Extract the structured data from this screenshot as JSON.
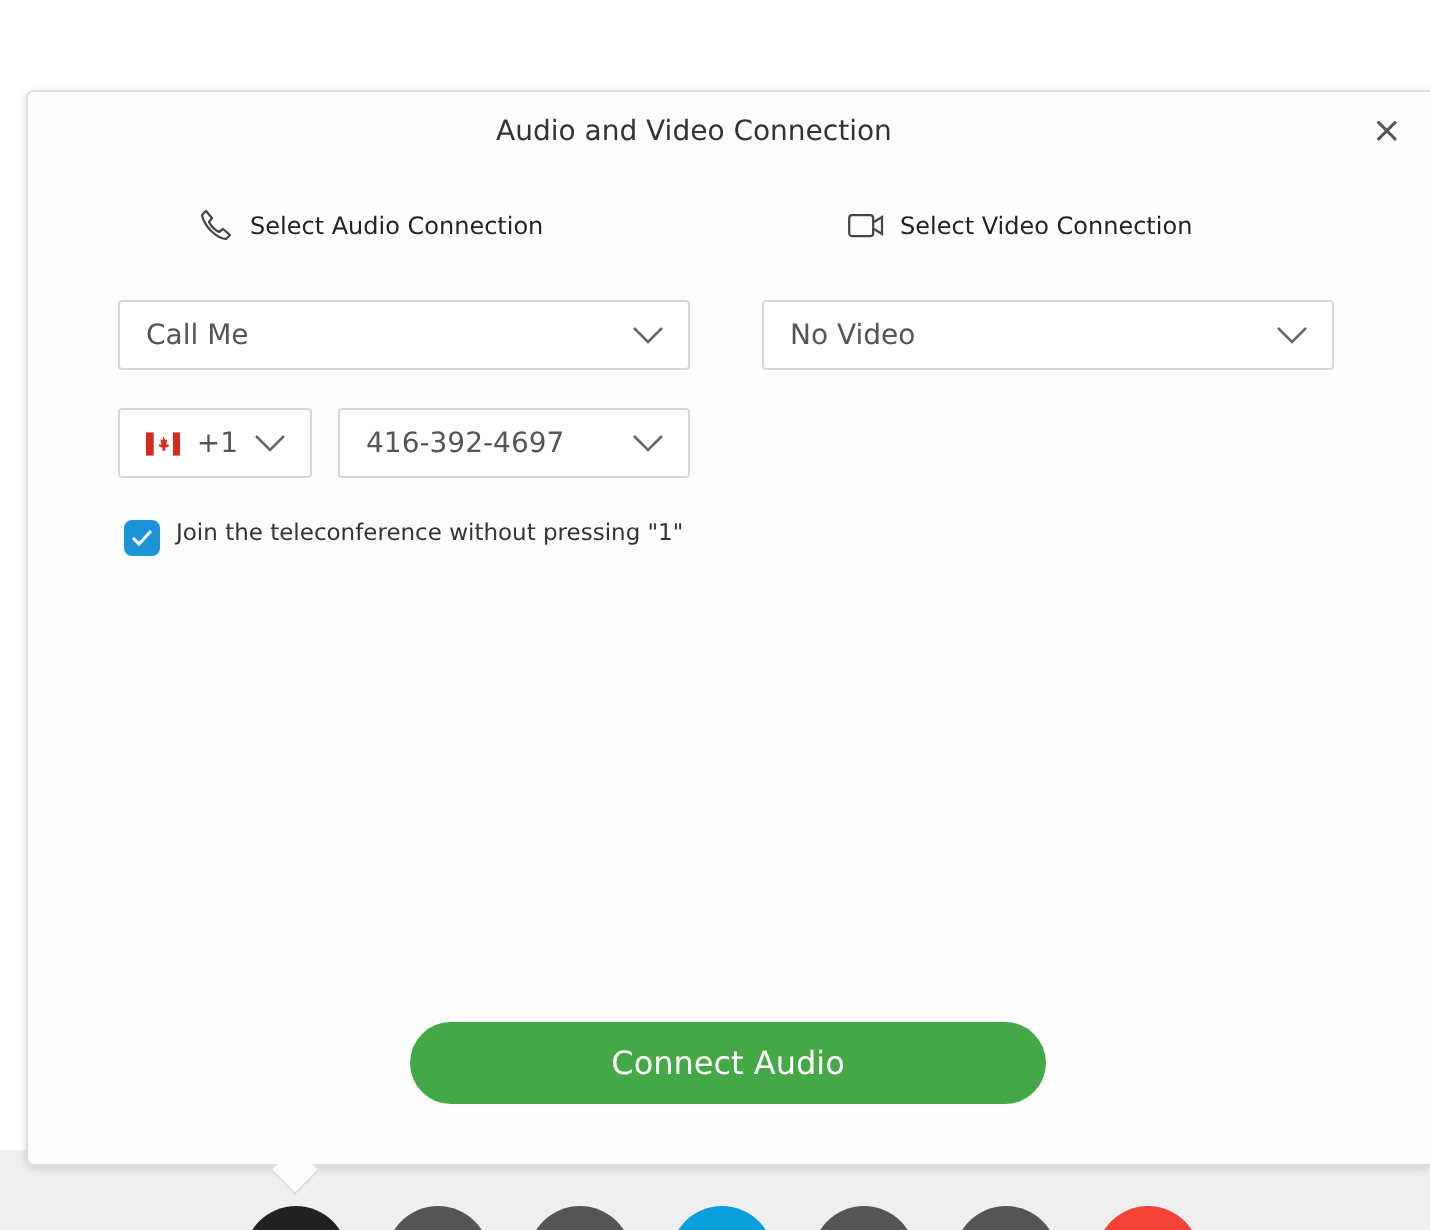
{
  "dialog": {
    "title": "Audio and Video Connection",
    "close": "×"
  },
  "audio": {
    "heading": "Select Audio Connection",
    "connection": "Call Me",
    "country_code": "+1",
    "phone": "416-392-4697",
    "join_option": {
      "label": "Join the teleconference without pressing \"1\"",
      "checked": true
    }
  },
  "video": {
    "heading": "Select Video Connection",
    "connection": "No Video"
  },
  "connect_button": "Connect Audio",
  "toolbar": [
    {
      "color": "#222222"
    },
    {
      "color": "#555555"
    },
    {
      "color": "#555555"
    },
    {
      "color": "#0a9fdc"
    },
    {
      "color": "#555555"
    },
    {
      "color": "#555555"
    },
    {
      "color": "#f44336"
    }
  ]
}
